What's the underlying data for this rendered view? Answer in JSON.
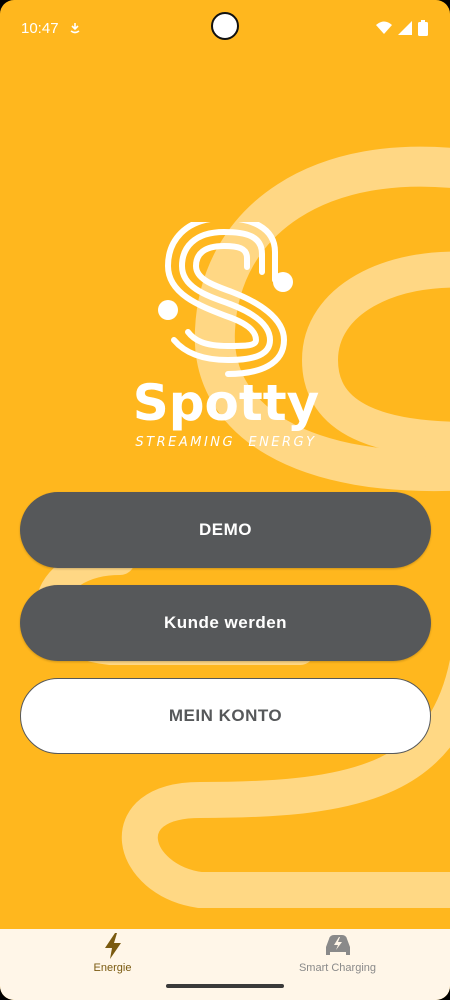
{
  "status_bar": {
    "time": "10:47"
  },
  "brand": {
    "name": "Spotty",
    "tagline": "STREAMING  ENERGY"
  },
  "buttons": {
    "demo": "DEMO",
    "become_customer": "Kunde werden",
    "my_account": "MEIN KONTO"
  },
  "bottom_nav": {
    "items": [
      {
        "label": "Energie",
        "icon": "lightning-icon",
        "active": true
      },
      {
        "label": "Smart Charging",
        "icon": "car-charging-icon",
        "active": false
      }
    ]
  },
  "colors": {
    "background": "#FFB71E",
    "swirl": "#FFD98A",
    "button_dark": "#56585A",
    "button_light": "#FFFFFF",
    "nav_active": "#7A5A10",
    "nav_inactive": "#8A8A8A",
    "navbar_bg": "#FFF6E8"
  }
}
